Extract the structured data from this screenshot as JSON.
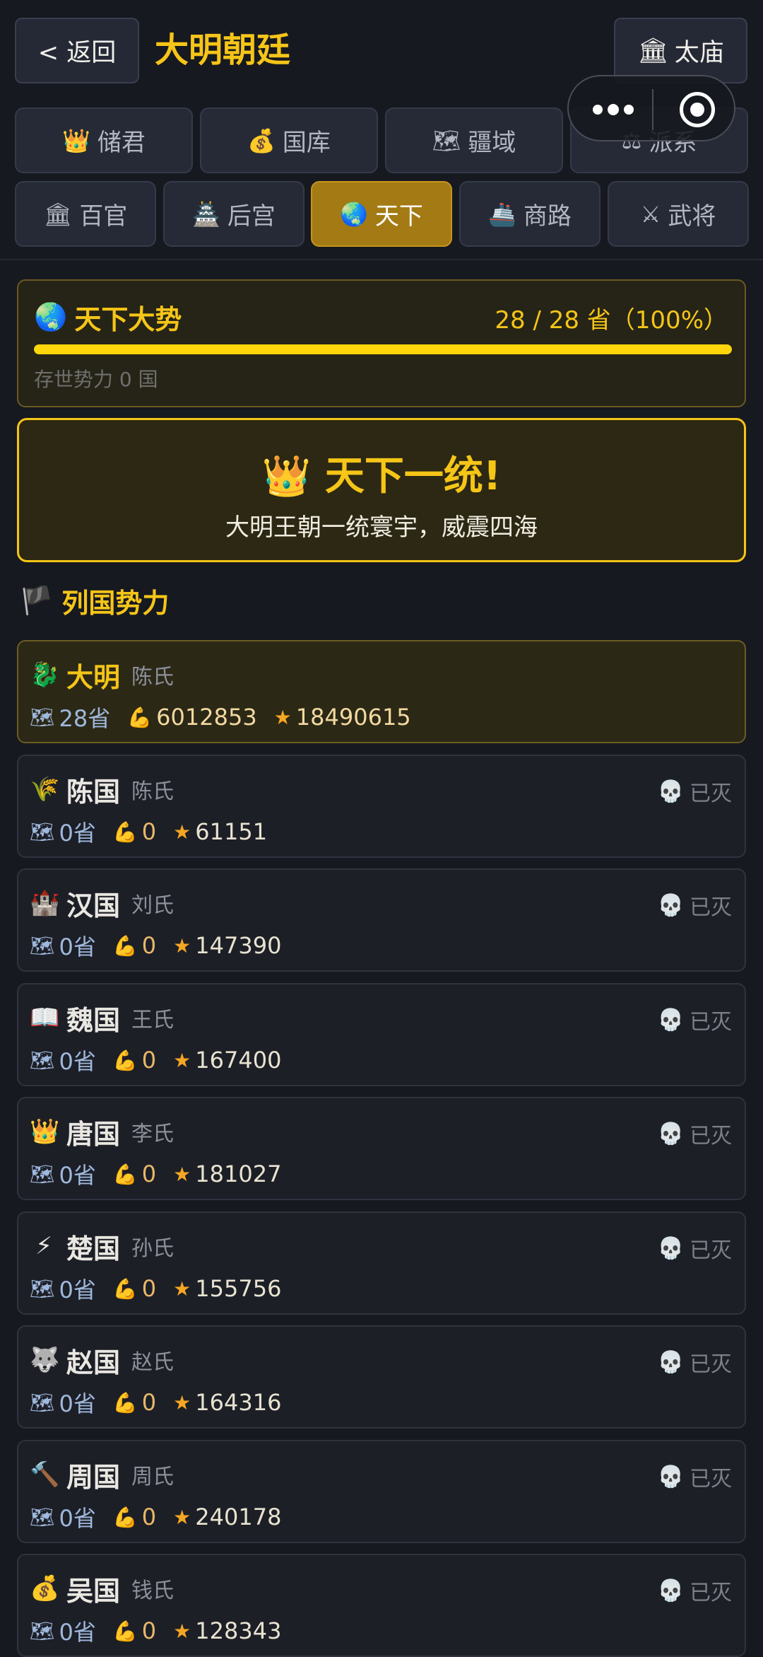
{
  "header": {
    "back_label": "< 返回",
    "title": "大明朝廷",
    "temple_icon": "🏛",
    "temple_label": "太庙"
  },
  "tabs_row1": [
    {
      "icon": "👑",
      "label": "储君"
    },
    {
      "icon": "💰",
      "label": "国库"
    },
    {
      "icon": "🗺",
      "label": "疆域"
    },
    {
      "icon": "⚖",
      "label": "派系"
    }
  ],
  "tabs_row2": [
    {
      "icon": "🏛",
      "label": "百官"
    },
    {
      "icon": "🏯",
      "label": "后宫"
    },
    {
      "icon": "🌏",
      "label": "天下",
      "active": true
    },
    {
      "icon": "🚢",
      "label": "商路"
    },
    {
      "icon": "⚔",
      "label": "武将"
    }
  ],
  "trend": {
    "icon": "🌏",
    "title": "天下大势",
    "count_text": "28 / 28 省（100%）",
    "progress_percent": 100,
    "sub": "存世势力 0 国"
  },
  "unity": {
    "icon": "👑",
    "title": "天下一统!",
    "subtitle": "大明王朝一统寰宇，威震四海"
  },
  "section": {
    "icon": "🏴",
    "title": "列国势力"
  },
  "colors": {
    "accent": "#f5c518",
    "active_tab": "#a37a14",
    "background": "#171920"
  },
  "nations": [
    {
      "icon": "🐉",
      "name": "大明",
      "clan": "陈氏",
      "provinces": "28省",
      "power": "6012853",
      "score": "18490615",
      "ours": true,
      "status": ""
    },
    {
      "icon": "🌾",
      "name": "陈国",
      "clan": "陈氏",
      "provinces": "0省",
      "power": "0",
      "score": "61151",
      "status": "已灭"
    },
    {
      "icon": "🏰",
      "name": "汉国",
      "clan": "刘氏",
      "provinces": "0省",
      "power": "0",
      "score": "147390",
      "status": "已灭"
    },
    {
      "icon": "📖",
      "name": "魏国",
      "clan": "王氏",
      "provinces": "0省",
      "power": "0",
      "score": "167400",
      "status": "已灭"
    },
    {
      "icon": "👑",
      "name": "唐国",
      "clan": "李氏",
      "provinces": "0省",
      "power": "0",
      "score": "181027",
      "status": "已灭"
    },
    {
      "icon": "⚡",
      "name": "楚国",
      "clan": "孙氏",
      "provinces": "0省",
      "power": "0",
      "score": "155756",
      "status": "已灭"
    },
    {
      "icon": "🐺",
      "name": "赵国",
      "clan": "赵氏",
      "provinces": "0省",
      "power": "0",
      "score": "164316",
      "status": "已灭"
    },
    {
      "icon": "🔨",
      "name": "周国",
      "clan": "周氏",
      "provinces": "0省",
      "power": "0",
      "score": "240178",
      "status": "已灭"
    },
    {
      "icon": "💰",
      "name": "吴国",
      "clan": "钱氏",
      "provinces": "0省",
      "power": "0",
      "score": "128343",
      "status": "已灭"
    }
  ]
}
